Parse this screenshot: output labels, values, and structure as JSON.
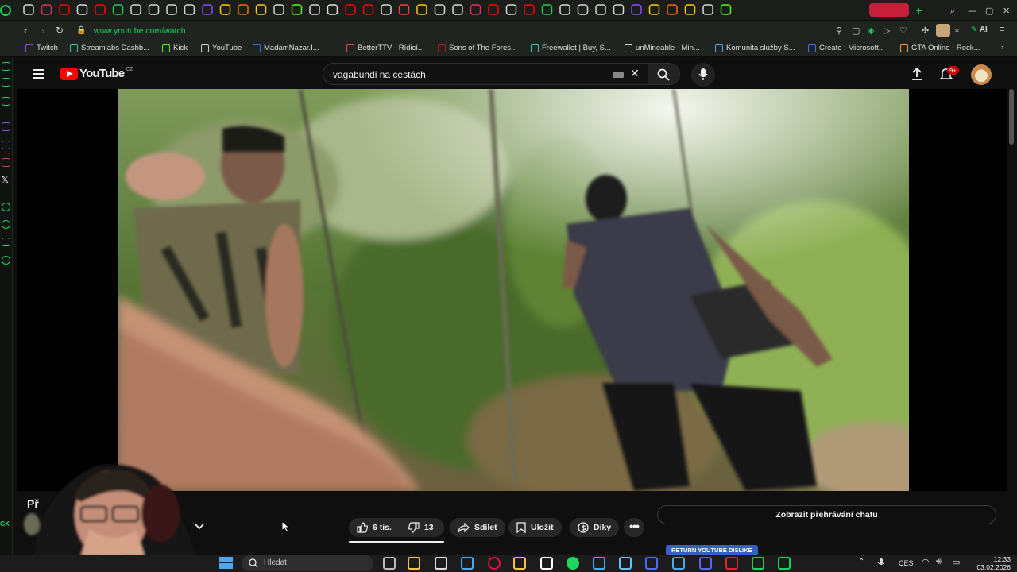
{
  "browser": {
    "url": "www.youtube.com/watch",
    "bookmarks": [
      {
        "label": "Twitch",
        "color": "#9147ff"
      },
      {
        "label": "Streamlabs Dashb...",
        "color": "#31c3a2"
      },
      {
        "label": "Kick",
        "color": "#53fc18"
      },
      {
        "label": "YouTube",
        "color": "#cccccc"
      },
      {
        "label": "MadamNazar.I...",
        "color": "#3a6ad9"
      },
      {
        "label": "BetterTTV - Řídicí...",
        "color": "#d44"
      },
      {
        "label": "Sons of The Fores...",
        "color": "#b31b1b"
      },
      {
        "label": "Freewallet | Buy, S...",
        "color": "#2bd1a8"
      },
      {
        "label": "unMineable - Min...",
        "color": "#cccccc"
      },
      {
        "label": "Komunita služby S...",
        "color": "#5c9bd6"
      },
      {
        "label": "Create | Microsoft...",
        "color": "#4a6cf7"
      },
      {
        "label": "GTA Online - Rock...",
        "color": "#f5a623"
      }
    ],
    "ai_label": "AI"
  },
  "youtube": {
    "logo_text": "YouTube",
    "region": "CZ",
    "search_value": "vagabundi na cestách",
    "notification_count": "9+",
    "title_partial": "Př",
    "actions": {
      "likes": "6 tis.",
      "dislikes": "13",
      "share": "Sdílet",
      "save": "Uložit",
      "thanks": "Díky"
    },
    "chat_button": "Zobrazit přehrávání chatu",
    "rytd_label": "RETURN YOUTUBE DISLIKE"
  },
  "taskbar": {
    "search_placeholder": "Hledat",
    "language": "CES",
    "time": "12:33",
    "date": "03.02.2026"
  },
  "colors": {
    "opera_green": "#19d25a",
    "yt_red": "#ff0000",
    "accent": "#3ea6ff"
  }
}
